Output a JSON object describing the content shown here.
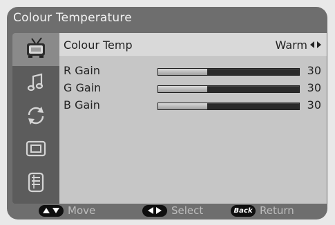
{
  "window": {
    "title": "Colour Temperature"
  },
  "sidebar": {
    "items": [
      {
        "icon": "tv-icon",
        "active": true
      },
      {
        "icon": "music-note-icon",
        "active": false
      },
      {
        "icon": "refresh-icon",
        "active": false
      },
      {
        "icon": "picture-in-picture-icon",
        "active": false
      },
      {
        "icon": "settings-panel-icon",
        "active": false
      }
    ]
  },
  "settings": {
    "colour_temp": {
      "label": "Colour Temp",
      "value": "Warm"
    },
    "r_gain": {
      "label": "R Gain",
      "value": "30",
      "level": 0.35
    },
    "g_gain": {
      "label": "G Gain",
      "value": "30",
      "level": 0.35
    },
    "b_gain": {
      "label": "B Gain",
      "value": "30",
      "level": 0.35
    }
  },
  "footer": {
    "move": "Move",
    "select": "Select",
    "back_key": "Back",
    "return": "Return"
  }
}
